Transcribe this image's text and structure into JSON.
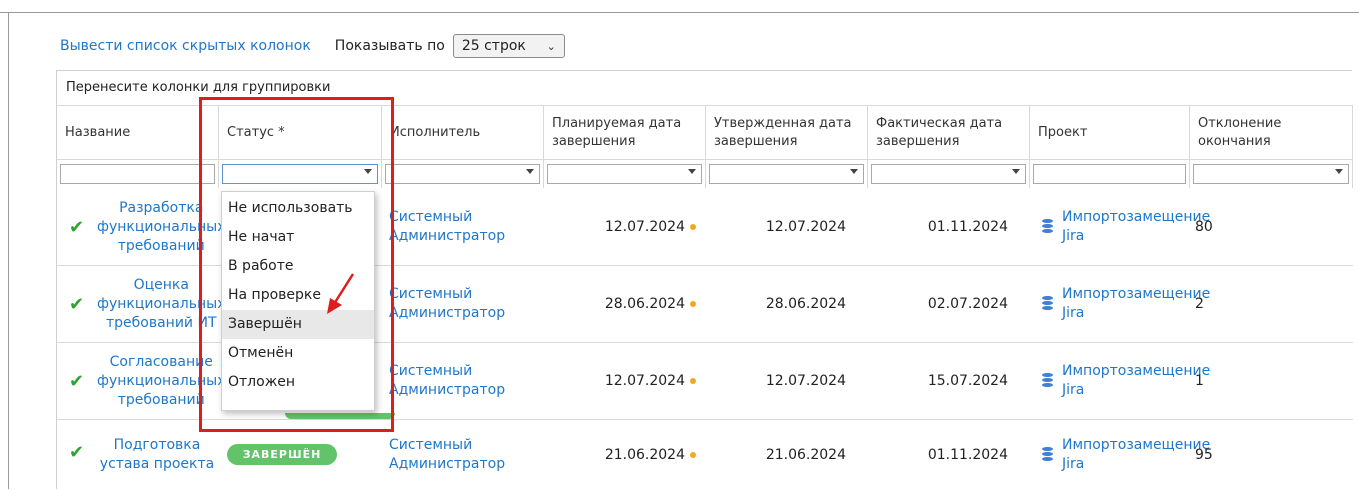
{
  "toolbar": {
    "hidden_columns_link": "Вывести список скрытых колонок",
    "show_label": "Показывать по",
    "rows_select_value": "25 строк"
  },
  "grid": {
    "group_hint": "Перенесите колонки для группировки",
    "columns": [
      {
        "label": "Название"
      },
      {
        "label": "Статус *"
      },
      {
        "label": "Исполнитель"
      },
      {
        "label": "Планируемая дата завершения"
      },
      {
        "label": "Утвержденная дата завершения"
      },
      {
        "label": "Фактическая дата завершения"
      },
      {
        "label": "Проект"
      },
      {
        "label": "Отклонение окончания"
      }
    ],
    "rows": [
      {
        "name": "Разработка функциональных требований",
        "status": "",
        "assignee": "Системный Администратор",
        "planned": "12.07.2024",
        "approved": "12.07.2024",
        "actual": "01.11.2024",
        "project": "Импортозамещение Jira",
        "deviation": "80"
      },
      {
        "name": "Оценка функциональных требований ИТ",
        "status": "",
        "assignee": "Системный Администратор",
        "planned": "28.06.2024",
        "approved": "28.06.2024",
        "actual": "02.07.2024",
        "project": "Импортозамещение Jira",
        "deviation": "2"
      },
      {
        "name": "Согласование функциональных требований",
        "status": "",
        "assignee": "Системный Администратор",
        "planned": "12.07.2024",
        "approved": "12.07.2024",
        "actual": "15.07.2024",
        "project": "Импортозамещение Jira",
        "deviation": "1"
      },
      {
        "name": "Подготовка устава проекта",
        "status": "ЗАВЕРШЁН",
        "assignee": "Системный Администратор",
        "planned": "21.06.2024",
        "approved": "21.06.2024",
        "actual": "01.11.2024",
        "project": "Импортозамещение Jira",
        "deviation": "95"
      }
    ]
  },
  "status_dropdown": {
    "options": [
      "Не использовать",
      "Не начат",
      "В работе",
      "На проверке",
      "Завершён",
      "Отменён",
      "Отложен"
    ],
    "highlighted": "Завершён"
  },
  "colors": {
    "link": "#1f77c9",
    "check": "#2fa52f",
    "badge": "#63c36b",
    "dot": "#f5a623",
    "annotation": "#e01d1d"
  }
}
